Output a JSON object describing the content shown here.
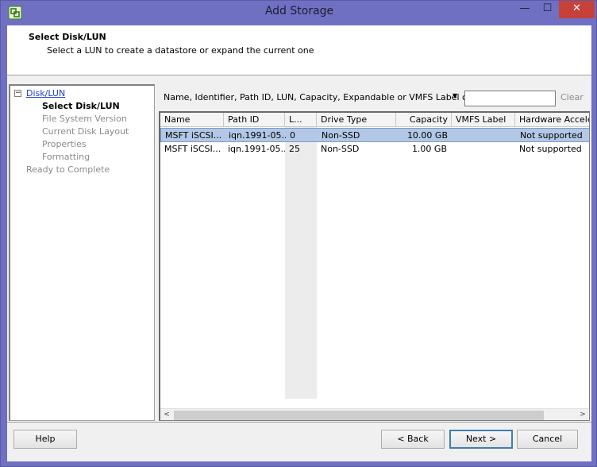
{
  "window": {
    "title": "Add Storage",
    "minimize_glyph": "—",
    "maximize_glyph": "☐",
    "close_glyph": "✕",
    "app_icon": "vsphere-icon"
  },
  "header": {
    "title": "Select Disk/LUN",
    "subtitle": "Select a LUN to create a datastore or expand the current one"
  },
  "steps": {
    "collapse_glyph": "−",
    "items": [
      {
        "label": "Disk/LUN",
        "state": "link"
      },
      {
        "label": "Select Disk/LUN",
        "state": "active"
      },
      {
        "label": "File System Version",
        "state": "pending"
      },
      {
        "label": "Current Disk Layout",
        "state": "pending"
      },
      {
        "label": "Properties",
        "state": "pending"
      },
      {
        "label": "Formatting",
        "state": "pending"
      },
      {
        "label": "Ready to Complete",
        "state": "pending"
      }
    ]
  },
  "filter": {
    "label": "Name, Identifier, Path ID, LUN, Capacity, Expandable or VMFS Label c...",
    "dropdown_glyph": "▼",
    "value": "",
    "clear_label": "Clear"
  },
  "table": {
    "columns": [
      "Name",
      "Path ID",
      "L...",
      "Drive Type",
      "Capacity",
      "VMFS Label",
      "Hardware Acceleration"
    ],
    "rows": [
      {
        "name": "MSFT iSCSI...",
        "path_id": "iqn.1991-05....",
        "lun": "0",
        "drive_type": "Non-SSD",
        "capacity": "10.00 GB",
        "vmfs_label": "",
        "hw_accel": "Not supported",
        "selected": true
      },
      {
        "name": "MSFT iSCSI...",
        "path_id": "iqn.1991-05....",
        "lun": "25",
        "drive_type": "Non-SSD",
        "capacity": "1.00 GB",
        "vmfs_label": "",
        "hw_accel": "Not supported",
        "selected": false
      }
    ],
    "scroll_left_glyph": "<",
    "scroll_right_glyph": ">"
  },
  "buttons": {
    "help": "Help",
    "back": "< Back",
    "next": "Next >",
    "cancel": "Cancel"
  },
  "colors": {
    "window_frame": "#6f70c2",
    "close_button": "#c7413b",
    "selection": "#b3c8e6",
    "link": "#1f3fd1"
  }
}
